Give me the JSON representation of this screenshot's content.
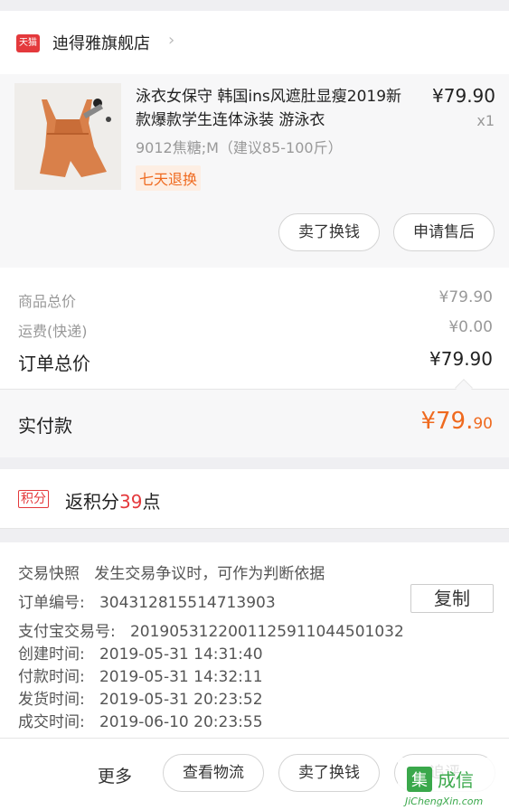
{
  "store": {
    "badge": "天猫",
    "name": "迪得雅旗舰店",
    "chevron": "›"
  },
  "product": {
    "title": "泳衣女保守 韩国ins风遮肚显瘦2019新款爆款学生连体泳装 游泳衣",
    "price": "¥79.90",
    "qty": "x1",
    "spec": "9012焦糖;M（建议85-100斤）",
    "tag": "七天退换",
    "thumb_icon": "swimsuit-photo"
  },
  "actions": {
    "sell_label": "卖了换钱",
    "after_sale_label": "申请售后"
  },
  "totals": {
    "goods_label": "商品总价",
    "goods_value": "¥79.90",
    "shipping_label": "运费(快递)",
    "shipping_value": "¥0.00",
    "order_total_label": "订单总价",
    "order_total_value": "¥79.90",
    "paid_label": "实付款",
    "paid_big": "¥79.",
    "paid_small": "90"
  },
  "points": {
    "badge": "积分",
    "prefix": "返积分",
    "value": "39",
    "suffix": "点"
  },
  "order_info": {
    "snapshot_label": "交易快照",
    "snapshot_desc": "发生交易争议时，可作为判断依据",
    "order_no_label": "订单编号:",
    "order_no": "304312815514713903",
    "copy_label": "复制",
    "alipay_label": "支付宝交易号:",
    "alipay_no": "2019053122001125911044501032",
    "created_label": "创建时间:",
    "created": "2019-05-31 14:31:40",
    "paid_label": "付款时间:",
    "paid": "2019-05-31 14:32:11",
    "shipped_label": "发货时间:",
    "shipped": "2019-05-31 20:23:52",
    "done_label": "成交时间:",
    "done": "2019-06-10 20:23:55"
  },
  "bottom_bar": {
    "more_label": "更多",
    "logistics_label": "查看物流",
    "sell_label": "卖了换钱",
    "review_label": "追评"
  },
  "colors": {
    "accent": "#ef6a1f",
    "tmall_red": "#e4393c"
  },
  "watermark": {
    "site": "JiChengXin.com"
  }
}
